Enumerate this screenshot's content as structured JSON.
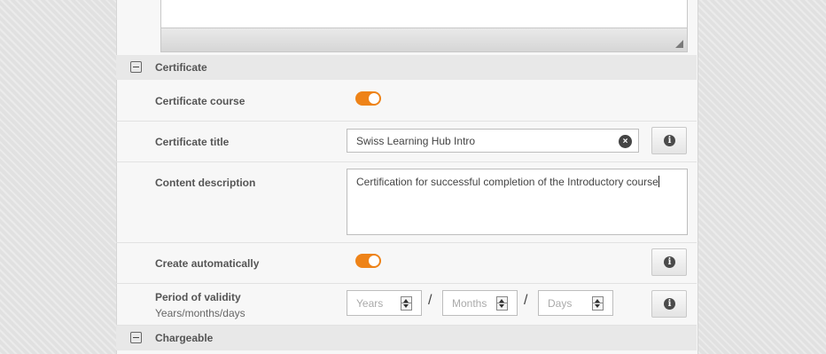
{
  "icons": {
    "collapse": "minus-square-icon",
    "clear": "clear-circle-icon",
    "info": "info-circle-icon",
    "resize": "resize-grip-icon"
  },
  "colors": {
    "toggle_on": "#ee8318"
  },
  "sections": {
    "certificate": {
      "title": "Certificate"
    },
    "chargeable": {
      "title": "Chargeable"
    }
  },
  "fields": {
    "certificate_course": {
      "label": "Certificate course",
      "enabled": true
    },
    "certificate_title": {
      "label": "Certificate title",
      "value": "Swiss Learning Hub Intro",
      "clear_glyph": "×",
      "info_glyph": "i"
    },
    "content_description": {
      "label": "Content description",
      "value": "Certification for successful completion of the Introductory course"
    },
    "create_automatically": {
      "label": "Create automatically",
      "enabled": true,
      "info_glyph": "i"
    },
    "period_of_validity": {
      "label": "Period of validity",
      "sublabel": "Years/months/days",
      "years_placeholder": "Years",
      "months_placeholder": "Months",
      "days_placeholder": "Days",
      "separator": "/",
      "info_glyph": "i"
    }
  }
}
